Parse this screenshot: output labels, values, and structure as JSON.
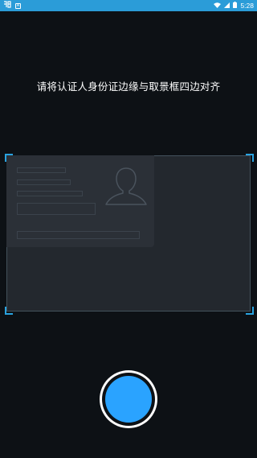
{
  "status_bar": {
    "app_icon_glyph": "ᚈ",
    "notification_icon_glyph": "A",
    "time": "5:28",
    "icons": [
      "wifi-icon",
      "signal-icon",
      "battery-icon"
    ]
  },
  "instruction": "请将认证人身份证边缘与取景框四边对齐",
  "colors": {
    "status_bar": "#2b9cd8",
    "background": "#0d1115",
    "frame_corner": "#29a3e0",
    "shutter": "#2aa3ff"
  }
}
